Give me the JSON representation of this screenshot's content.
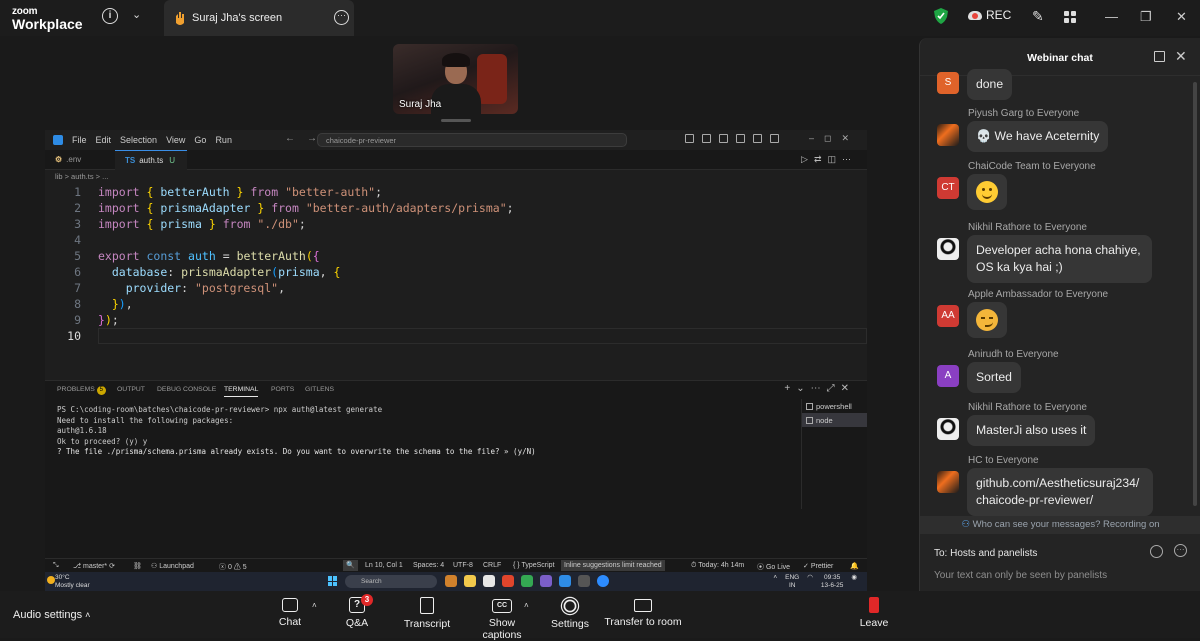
{
  "app": {
    "brand_top": "zoom",
    "brand_bottom": "Workplace",
    "info_icon": "info-icon",
    "share_tab_label": "Suraj Jha's screen",
    "rec_label": "REC"
  },
  "video": {
    "name": "Suraj Jha"
  },
  "vscode": {
    "menu": [
      "File",
      "Edit",
      "Selection",
      "View",
      "Go",
      "Run"
    ],
    "search": "chaicode-pr-reviewer",
    "tabs": [
      {
        "label": ".env"
      },
      {
        "label": "auth.ts",
        "badge": "U"
      }
    ],
    "breadcrumb": "lib  >  auth.ts  > ...",
    "code_lines": [
      "1",
      "2",
      "3",
      "4",
      "5",
      "6",
      "7",
      "8",
      "9",
      "10"
    ],
    "panel_tabs": [
      "PROBLEMS",
      "OUTPUT",
      "DEBUG CONSOLE",
      "TERMINAL",
      "PORTS",
      "GITLENS"
    ],
    "problems_count": "5",
    "terminal_lines": [
      "PS C:\\coding-room\\batches\\chaicode-pr-reviewer> npx auth@latest generate",
      "  Need to install the following packages:",
      "  auth@1.6.18",
      "  Ok to proceed? (y) y",
      "? The file ./prisma/schema.prisma already exists. Do you want to overwrite the schema to the file? » (y/N)"
    ],
    "terminal_list": [
      "powershell",
      "node"
    ],
    "status": {
      "branch": "master*",
      "launchpad": "Launchpad",
      "problems": "ⓧ 0 ⚠ 5",
      "position": "Ln 10, Col 1",
      "spaces": "Spaces: 4",
      "encoding": "UTF-8",
      "eol": "CRLF",
      "lang": "TypeScript",
      "inline": "Inline suggestions limit reached",
      "today": "Today: 4h 14m",
      "golive": "Go Live",
      "prettier": "Prettier"
    }
  },
  "taskbar": {
    "temp": "30°C",
    "weather": "Mostly clear",
    "search": "Search",
    "lang": "ENG",
    "region": "IN",
    "time": "09:35",
    "date": "13-6-25"
  },
  "chat": {
    "title": "Webinar chat",
    "messages": [
      {
        "sender": "",
        "avatar": "S",
        "text": "done"
      },
      {
        "sender": "Piyush Garg to Everyone",
        "avatar": "",
        "text": "💀 We have Aceternity"
      },
      {
        "sender": "ChaiCode Team to Everyone",
        "avatar": "CT",
        "text": ""
      },
      {
        "sender": "Nikhil Rathore to Everyone",
        "avatar": "",
        "text": "Developer acha hona chahiye, OS ka kya hai ;)"
      },
      {
        "sender": "Apple Ambassador to Everyone",
        "avatar": "AA",
        "text": ""
      },
      {
        "sender": "Anirudh to Everyone",
        "avatar": "A",
        "text": "Sorted"
      },
      {
        "sender": "Nikhil Rathore to Everyone",
        "avatar": "",
        "text": "MasterJi also uses it"
      },
      {
        "sender": "HC to Everyone",
        "avatar": "",
        "text": "github.com/Aestheticsuraj234/chaicode-pr-reviewer/"
      }
    ],
    "note": "Who can see your messages? Recording on",
    "to_label": "To:  Hosts and panelists",
    "input_placeholder": "Your text can only be seen by panelists"
  },
  "toolbar": {
    "audio": "Audio settings",
    "buttons": [
      "Chat",
      "Q&A",
      "Transcript",
      "Show captions",
      "Settings",
      "Transfer to room",
      "Leave"
    ],
    "qa_badge": "3"
  }
}
